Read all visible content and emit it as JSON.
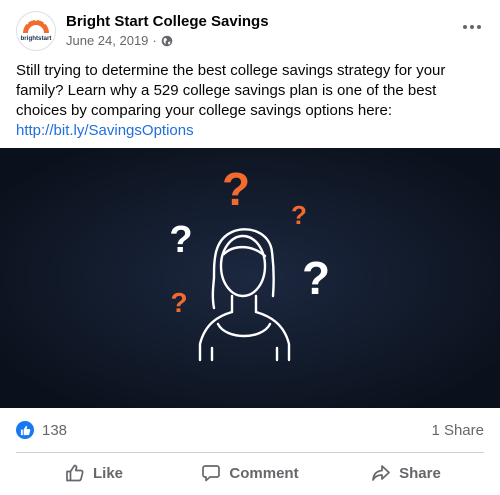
{
  "post": {
    "page_name": "Bright Start College Savings",
    "avatar_label": "brightstart",
    "date": "June 24, 2019",
    "separator": "·",
    "text": "Still trying to determine the best college savings strategy for your family? Learn why a 529 college savings plan is one of the best choices by comparing your college savings options here:",
    "link": "http://bit.ly/SavingsOptions"
  },
  "image": {
    "question_marks": [
      "?",
      "?",
      "?",
      "?",
      "?"
    ],
    "colors": {
      "background": "#0f1725",
      "orange": "#f26a2d",
      "white": "#ffffff"
    }
  },
  "stats": {
    "likes": "138",
    "shares": "1 Share"
  },
  "actions": {
    "like": "Like",
    "comment": "Comment",
    "share": "Share"
  },
  "colors": {
    "accent": "#1877f2",
    "link": "#216fdb",
    "muted": "#65676b"
  }
}
